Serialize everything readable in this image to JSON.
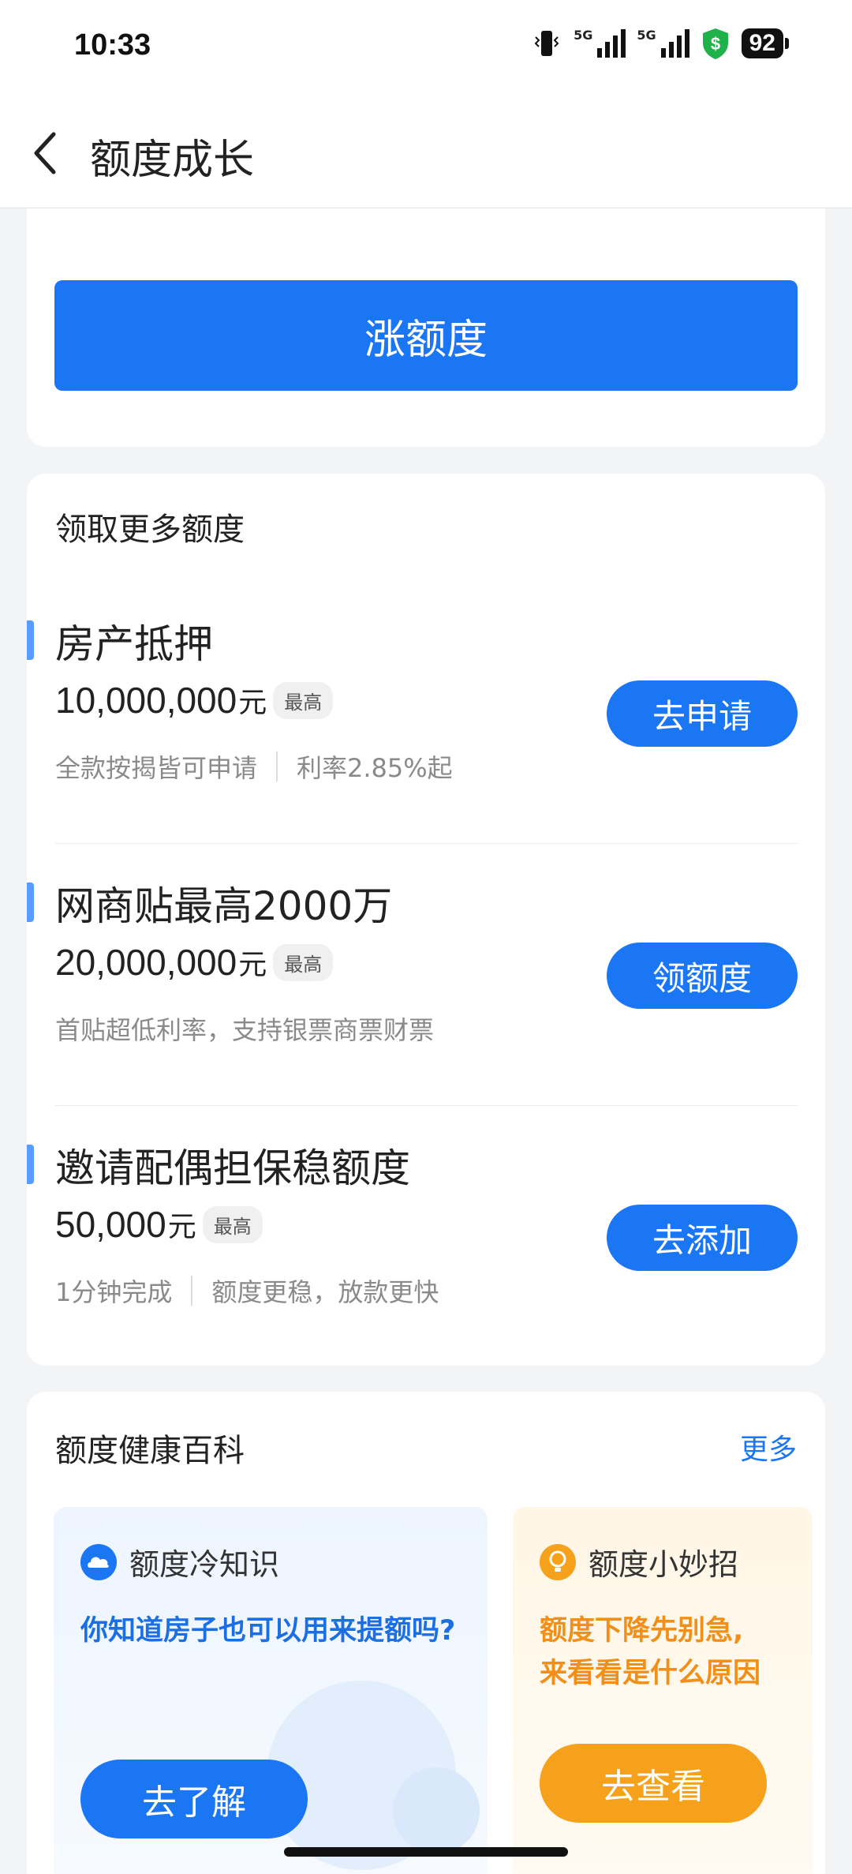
{
  "status_bar": {
    "time": "10:33",
    "battery": "92",
    "signal_label_1": "5G",
    "signal_label_2": "5G"
  },
  "nav": {
    "title": "额度成长"
  },
  "top_card": {
    "button_label": "涨额度"
  },
  "more_quota": {
    "title": "领取更多额度",
    "items": [
      {
        "title": "房产抵押",
        "amount": "10,000,000",
        "unit": "元",
        "tag": "最高",
        "desc": [
          "全款按揭皆可申请",
          "利率2.85%起"
        ],
        "action": "去申请"
      },
      {
        "title": "网商贴最高2000万",
        "amount": "20,000,000",
        "unit": "元",
        "tag": "最高",
        "desc": [
          "首贴超低利率，支持银票商票财票"
        ],
        "action": "领额度"
      },
      {
        "title": "邀请配偶担保稳额度",
        "amount": "50,000",
        "unit": "元",
        "tag": "最高",
        "desc": [
          "1分钟完成",
          "额度更稳，放款更快"
        ],
        "action": "去添加"
      }
    ]
  },
  "wiki": {
    "title": "额度健康百科",
    "more": "更多",
    "tiles": [
      {
        "header": "额度冷知识",
        "question": "你知道房子也可以用来提额吗?",
        "button": "去了解",
        "accent": "#1b76f4"
      },
      {
        "header": "额度小妙招",
        "question_line1": "额度下降先别急,",
        "question_line2": "来看看是什么原因",
        "button": "去查看",
        "accent": "#f5a11c"
      }
    ]
  }
}
